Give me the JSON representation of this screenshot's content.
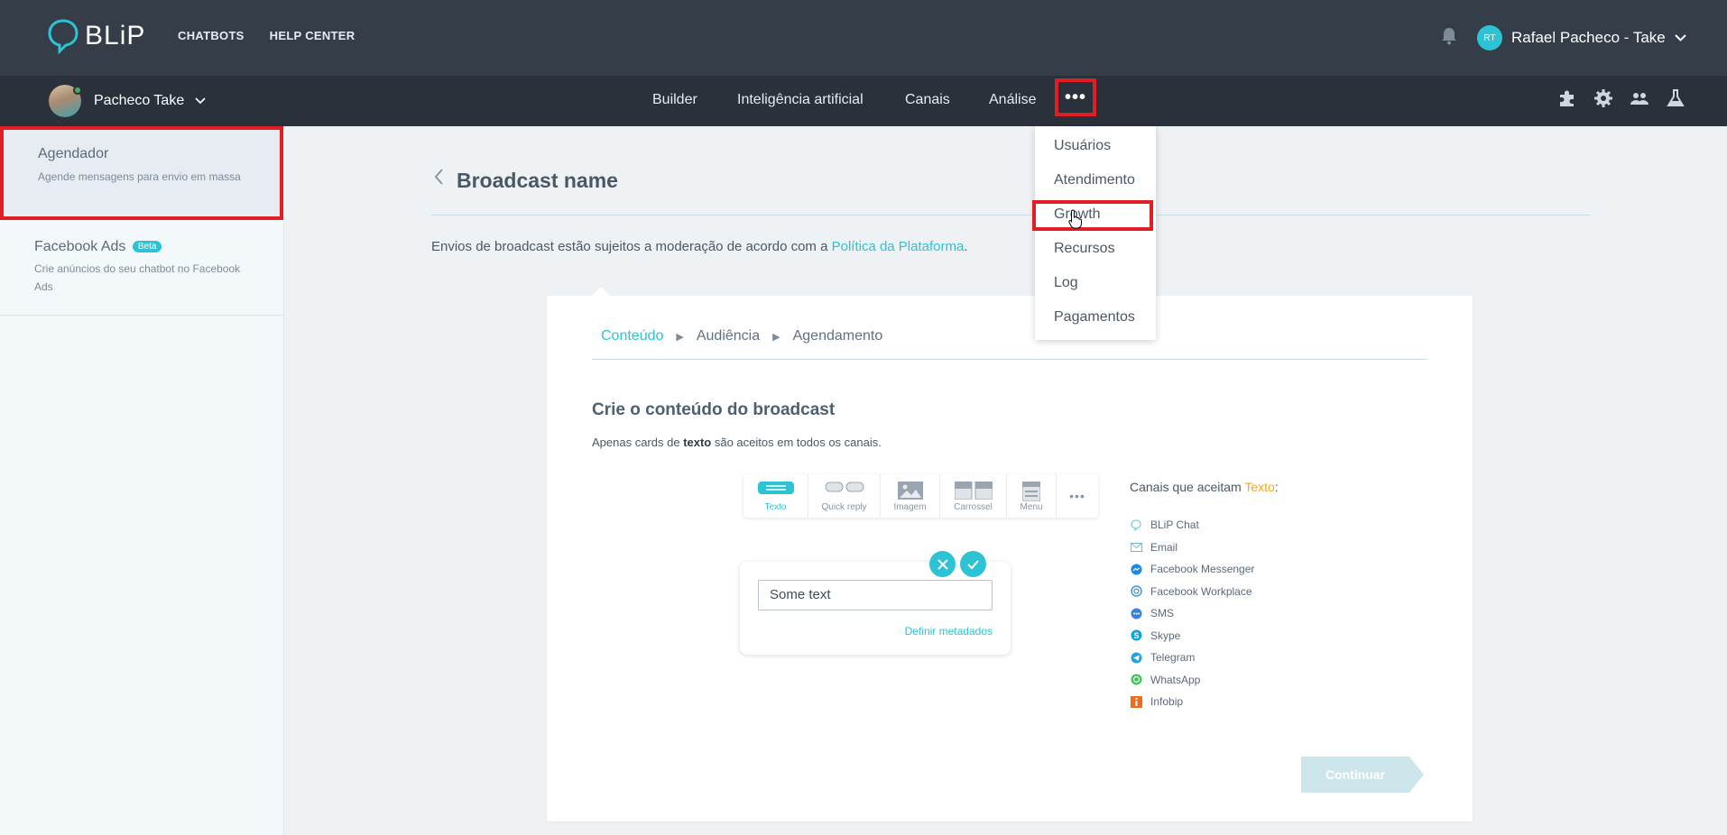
{
  "app": {
    "logo_text": "BLiP",
    "top_nav": [
      "CHATBOTS",
      "HELP CENTER"
    ],
    "user": {
      "initials": "RT",
      "name": "Rafael Pacheco - Take"
    }
  },
  "subbar": {
    "bot_name": "Pacheco Take",
    "nav": [
      "Builder",
      "Inteligência artificial",
      "Canais",
      "Análise"
    ],
    "more_label": "•••"
  },
  "dropdown": {
    "items": [
      "Usuários",
      "Atendimento",
      "Growth",
      "Recursos",
      "Log",
      "Pagamentos"
    ],
    "highlighted": "Growth"
  },
  "sidebar": {
    "items": [
      {
        "title": "Agendador",
        "desc": "Agende mensagens para envio em massa",
        "active": true
      },
      {
        "title": "Facebook Ads",
        "badge": "Beta",
        "desc": "Crie anúncios do seu chatbot no Facebook Ads",
        "active": false
      }
    ]
  },
  "main": {
    "title": "Broadcast name",
    "notice_text": "Envios de broadcast estão sujeitos a moderação de acordo com a ",
    "notice_link": "Política da Plataforma",
    "notice_end": ".",
    "steps": [
      "Conteúdo",
      "Audiência",
      "Agendamento"
    ],
    "content_title": "Crie o conteúdo do broadcast",
    "content_sub_pre": "Apenas cards de ",
    "content_sub_bold": "texto",
    "content_sub_post": " são aceitos em todos os canais.",
    "card_types": [
      {
        "label": "Texto",
        "icon": "text-card-icon",
        "selected": true
      },
      {
        "label": "Quick reply",
        "icon": "quick-reply-icon",
        "selected": false
      },
      {
        "label": "Imagem",
        "icon": "image-icon",
        "selected": false
      },
      {
        "label": "Carrossel",
        "icon": "carousel-icon",
        "selected": false
      },
      {
        "label": "Menu",
        "icon": "menu-icon",
        "selected": false
      },
      {
        "label": "•••",
        "icon": "more-icon",
        "selected": false
      }
    ],
    "text_value": "Some text",
    "metadata_link": "Definir metadados",
    "channels_title_pre": "Canais que aceitam ",
    "channels_title_hl": "Texto",
    "channels_title_post": ":",
    "channels": [
      {
        "name": "BLiP Chat",
        "icon": "blip-chat-icon",
        "color": "#6fd3e0"
      },
      {
        "name": "Email",
        "icon": "email-icon",
        "color": "#6fb8d8"
      },
      {
        "name": "Facebook Messenger",
        "icon": "messenger-icon",
        "color": "#1e88e5"
      },
      {
        "name": "Facebook Workplace",
        "icon": "workplace-icon",
        "color": "#4a90e2"
      },
      {
        "name": "SMS",
        "icon": "sms-icon",
        "color": "#3b82d6"
      },
      {
        "name": "Skype",
        "icon": "skype-icon",
        "color": "#0aa5e0"
      },
      {
        "name": "Telegram",
        "icon": "telegram-icon",
        "color": "#2aa0d8"
      },
      {
        "name": "WhatsApp",
        "icon": "whatsapp-icon",
        "color": "#43c45a"
      },
      {
        "name": "Infobip",
        "icon": "infobip-icon",
        "color": "#f06c1d"
      }
    ],
    "continue_label": "Continuar"
  },
  "colors": {
    "accent": "#2cc3d5",
    "highlight_box": "#e21e25",
    "topbar": "#353d49",
    "subbar": "#2a313b",
    "continue_disabled": "#cde6ec"
  }
}
